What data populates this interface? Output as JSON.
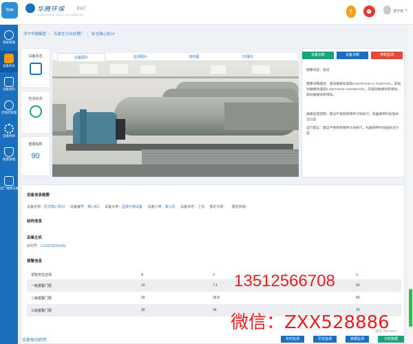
{
  "header": {
    "logo_label": "Yun Cloud",
    "brand_name": "华腾环保",
    "brand_sub": "HUATENG ENVIRONMENT",
    "brand_tag": "EIoT",
    "alarm_icon": "!",
    "clock_icon": "⏰",
    "user_name": "济宁市",
    "caret": "▾"
  },
  "sidebar": {
    "items": [
      {
        "label": "系统管理",
        "icon": "org-chart-icon"
      },
      {
        "label": "设备状态",
        "icon": "monitor-icon",
        "active": true
      },
      {
        "label": "设备资料",
        "icon": "document-icon"
      },
      {
        "label": "点巡检管理",
        "icon": "refresh-icon"
      },
      {
        "label": "设备检修",
        "icon": "gear-icon"
      },
      {
        "label": "隐患管理",
        "icon": "shield-icon"
      },
      {
        "label": "出厂维保记录",
        "icon": "edit-icon"
      }
    ]
  },
  "breadcrumb": [
    "济宁华德集团",
    "石家庄污水处理厂",
    "卧式离心机1#"
  ],
  "status_cards": {
    "device_status": "设备状态",
    "monitor_status": "检测状态",
    "health_index": "健康指数",
    "health_value": "90"
  },
  "image_tabs": [
    "设备图片",
    "监测图片",
    "结构图",
    "3D展示"
  ],
  "diagnosis": {
    "tabs": [
      {
        "label": "设备诊断",
        "color": "#1aa27a"
      },
      {
        "label": "设备诊断",
        "color": "#1b6fbf"
      },
      {
        "label": "参数监测",
        "color": "#e04a3a"
      }
    ],
    "health_status": "健康状态：良好",
    "health_desc": "健康详细描述：驱动轴振动速度8.5479mm/s~1.7632mm/s，非驱动轴振动速度9.4347mm/s~3.8436mm/s，非驱动轴振动有增加，驱动轴振动有增加。",
    "suggest": "故障处理措施：建议严格按照保养计划执行，机器保养时加强关注力度",
    "operation": "运行建议：建议严格按照保养计划执行，机器保养时加强关注力度"
  },
  "info": {
    "title": "设备信息概要",
    "fields": [
      {
        "label": "设备名称：",
        "value": "卧式离心机1#"
      },
      {
        "label": "设备编号：",
        "value": "离心机1"
      },
      {
        "label": "设备大类：",
        "value": "固液分离设备"
      },
      {
        "label": "设备小类：",
        "value": "离心机"
      },
      {
        "label": "设备状态：",
        "value": "上线"
      },
      {
        "label": "额定功率：",
        "value": ""
      },
      {
        "label": "额定转速：",
        "value": ""
      }
    ],
    "structure_title": "结构信息",
    "collector_title": "采集主机",
    "serial_label": "序列号：",
    "serial_value": "LC00216041202",
    "alarm_title": "报警信息",
    "alarm_headers": [
      "报警类型选择",
      "A",
      "V",
      "T",
      "C"
    ],
    "alarm_rows": [
      [
        "一级报警门限",
        "10",
        "7.1",
        "",
        "60"
      ],
      [
        "二级报警门限",
        "20",
        "18.8",
        "",
        "65"
      ],
      [
        "三级报警门限",
        "30",
        "24",
        "",
        "70"
      ]
    ],
    "bottom_title": "设备振动趋势",
    "buttons": [
      "实时监测",
      "历史监测",
      "数据监测",
      "分析数据"
    ]
  },
  "overlay": {
    "phone": "13512566708",
    "wechat": "微信：ZXX528886",
    "win": "激活 Windows"
  }
}
